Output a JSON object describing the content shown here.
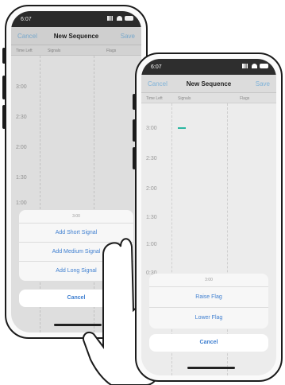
{
  "left_phone": {
    "status": {
      "time": "6:07"
    },
    "nav": {
      "cancel": "Cancel",
      "title": "New Sequence",
      "save": "Save"
    },
    "columns": [
      "Time Left",
      "Signals",
      "Flags"
    ],
    "rows": [
      "3:00",
      "2:30",
      "2:00",
      "1:30",
      "1:00"
    ],
    "sheet": {
      "title": "3:00",
      "actions": [
        "Add Short Signal",
        "Add Medium Signal",
        "Add Long Signal"
      ],
      "cancel": "Cancel"
    }
  },
  "right_phone": {
    "status": {
      "time": "6:07"
    },
    "nav": {
      "cancel": "Cancel",
      "title": "New Sequence",
      "save": "Save"
    },
    "columns": [
      "Time Left",
      "Signals",
      "Flags"
    ],
    "rows": [
      "3:00",
      "2:30",
      "2:00",
      "1:30",
      "1:00",
      "0:30"
    ],
    "sheet": {
      "title": "3:00",
      "actions": [
        "Raise Flag",
        "Lower Flag"
      ],
      "cancel": "Cancel"
    }
  },
  "colors": {
    "accent_blue": "#3f7fd0",
    "nav_link": "#7fb3d9",
    "signal_marker": "#2bb7a1"
  }
}
